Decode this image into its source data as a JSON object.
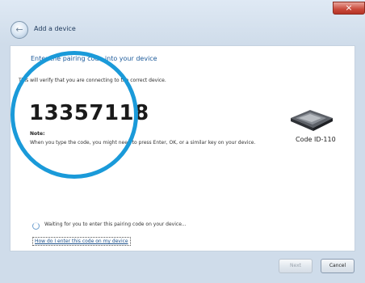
{
  "window": {
    "title": "Add a device",
    "close_glyph": "×"
  },
  "nav": {
    "back_glyph": "←"
  },
  "main": {
    "heading": "Enter the pairing code into your device",
    "subtext": "This will verify that you are connecting to the correct device.",
    "pairing_code": "13357118",
    "note_label": "Note:",
    "note_text": "When you type the code, you might need to press Enter, OK, or a similar key on your device."
  },
  "device": {
    "name": "Code ID-110",
    "icon": "mouse-device-icon"
  },
  "status": {
    "text": "Waiting for you to enter this pairing code on your device...",
    "icon": "spinner-icon"
  },
  "help_link": "How do I enter this code on my device",
  "buttons": {
    "next": "Next",
    "cancel": "Cancel"
  },
  "colors": {
    "highlight": "#1a9ad9",
    "heading": "#1c5a9a",
    "close": "#c9493b"
  }
}
